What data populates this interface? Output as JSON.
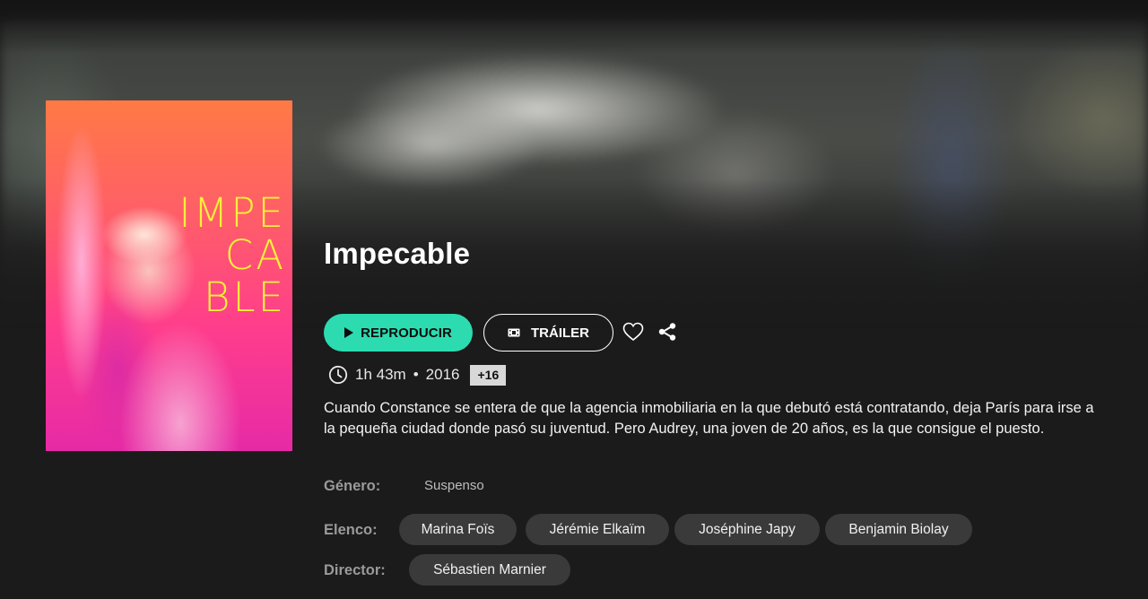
{
  "movie": {
    "poster_title_lines": [
      "IMPE",
      "CA",
      "BLE"
    ],
    "title": "Impecable",
    "duration": "1h 43m",
    "separator": "•",
    "year": "2016",
    "age_rating": "+16",
    "synopsis": "Cuando Constance se entera de que la agencia inmobiliaria en la que debutó está contratando, deja París para irse a la pequeña ciudad donde pasó su juventud. Pero Audrey, una joven de 20 años, es la que consigue el puesto."
  },
  "actions": {
    "play_label": "REPRODUCIR",
    "trailer_label": "TRÁILER",
    "favorite_icon": "heart-icon",
    "share_icon": "share-icon"
  },
  "details": {
    "genre_label": "Género:",
    "genre_value": "Suspenso",
    "cast_label": "Elenco:",
    "cast": [
      "Marina Foïs",
      "Jérémie Elkaïm",
      "Joséphine Japy",
      "Benjamin Biolay"
    ],
    "director_label": "Director:",
    "directors": [
      "Sébastien Marnier"
    ]
  },
  "colors": {
    "accent": "#2cdcb0",
    "background": "#1b1b1b",
    "chip": "#3a3a3a",
    "poster_title": "#f6f03a"
  }
}
